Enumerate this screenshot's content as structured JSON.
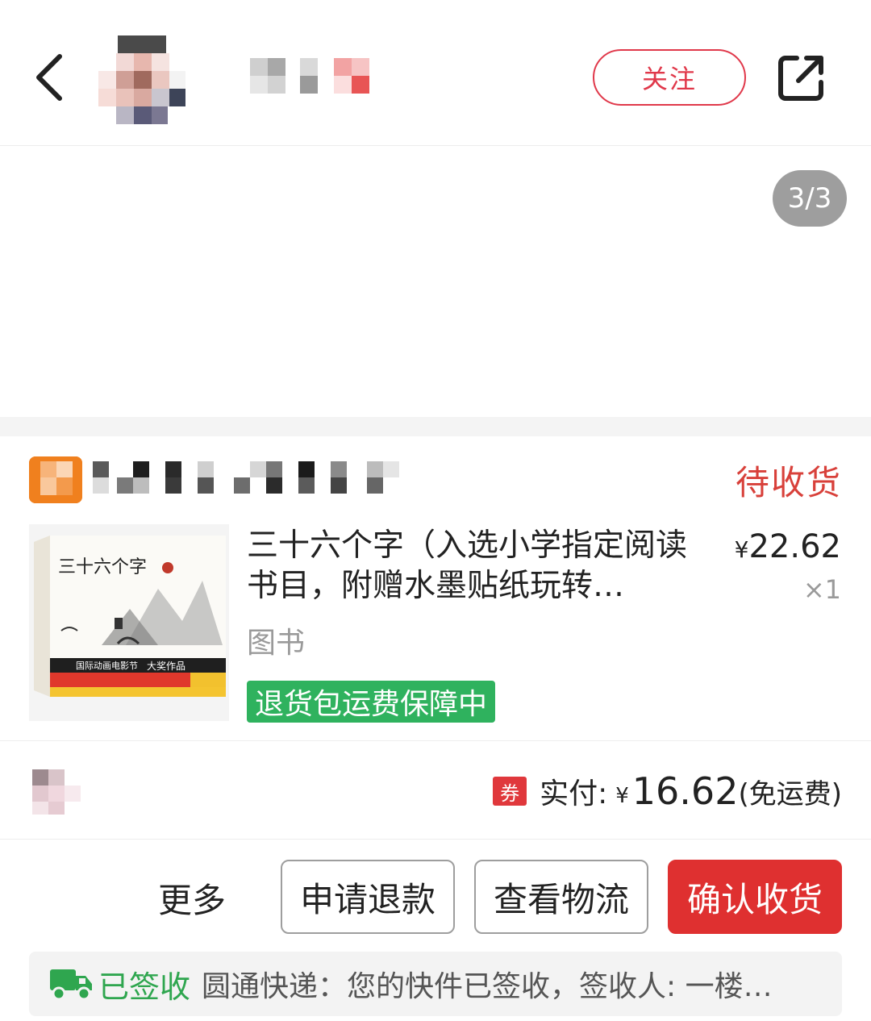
{
  "header": {
    "follow_label": "关注",
    "icons": [
      "back-arrow-icon",
      "share-icon"
    ]
  },
  "gallery": {
    "counter": "3/3"
  },
  "order": {
    "status": "待收货",
    "item": {
      "title": "三十六个字（入选小学指定阅读书目，附赠水墨贴纸玩转…",
      "category": "图书",
      "guarantee_badge": "退货包运费保障中",
      "price_symbol": "¥",
      "price_value": "22.62",
      "quantity": "×1",
      "cover": {
        "title": "三十六个字",
        "band_text": "国际动画电影节",
        "band_text2": "大奖作品"
      }
    },
    "payment": {
      "coupon_label": "券",
      "label": "实付:",
      "symbol": "¥",
      "amount": "16.62",
      "shipping_note": "(免运费)"
    },
    "actions": {
      "more": "更多",
      "refund": "申请退款",
      "logistics": "查看物流",
      "confirm": "确认收货"
    },
    "logistics": {
      "status": "已签收",
      "text": "圆通快递：您的快件已签收，签收人: 一楼…"
    }
  },
  "colors": {
    "accent_red": "#df3030",
    "status_red": "#d8403a",
    "follow_red": "#e0384a",
    "green": "#2fb25e",
    "shop_logo_orange": "#f0801e"
  }
}
